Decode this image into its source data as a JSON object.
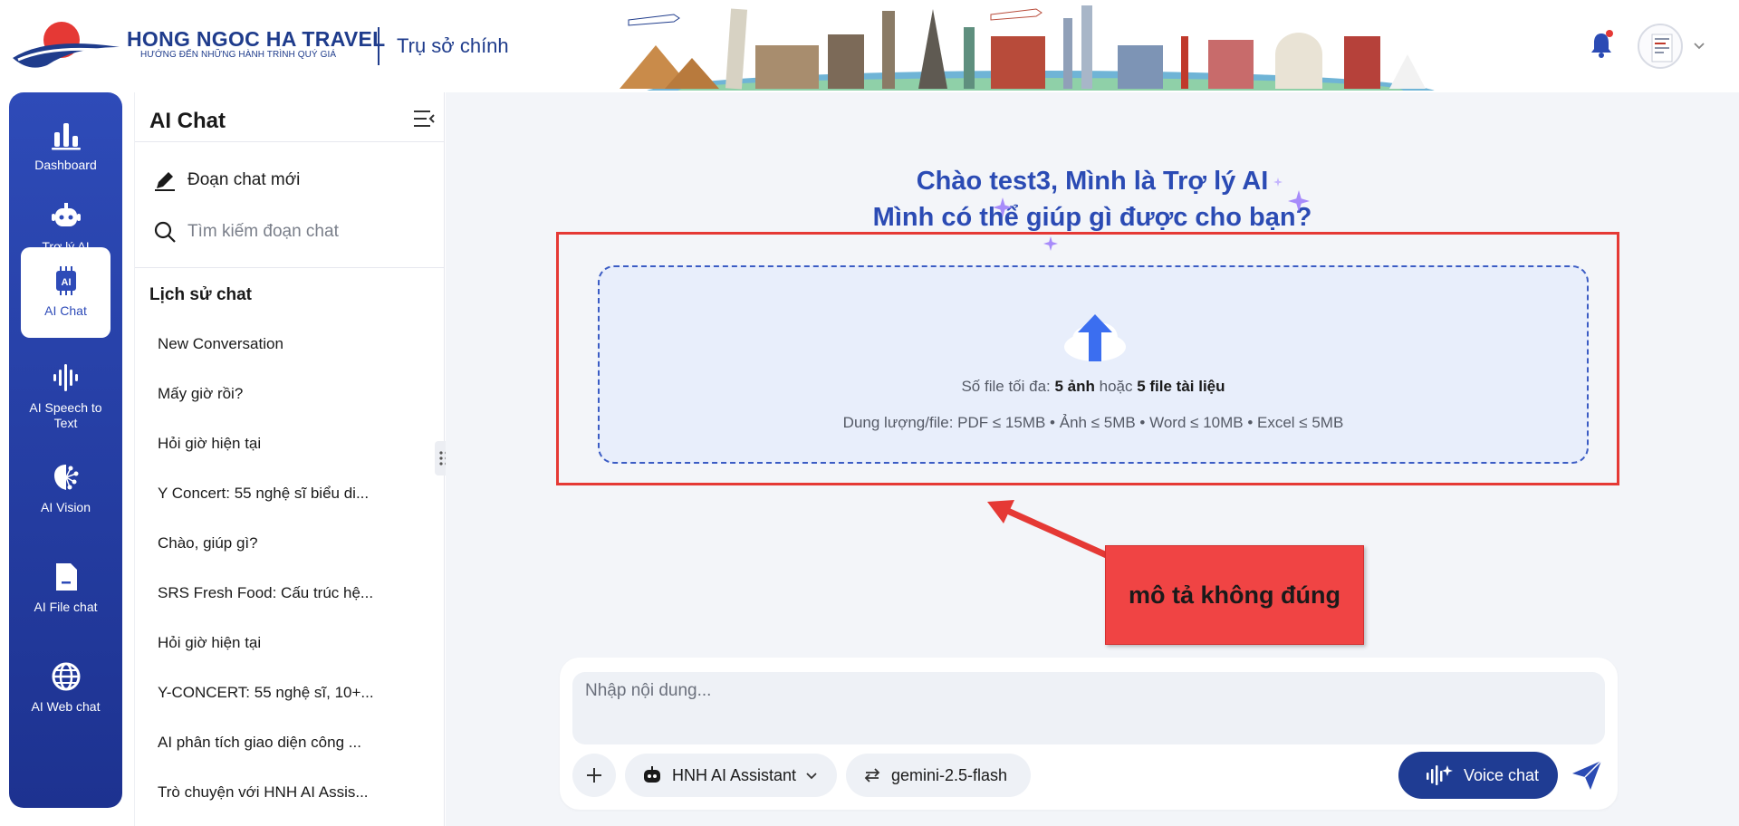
{
  "header": {
    "brand_name": "HONG NGOC HA TRAVEL",
    "brand_tagline": "HƯỚNG ĐẾN NHỮNG HÀNH TRÌNH QUÝ GIÁ",
    "office": "Trụ sở chính"
  },
  "rail": {
    "items": [
      {
        "label": "Dashboard",
        "icon": "bar-chart-icon"
      },
      {
        "label": "Trợ lý AI",
        "icon": "robot-icon"
      },
      {
        "label": "AI Chat",
        "icon": "ai-chip-icon",
        "active": true
      },
      {
        "label": "AI Speech to Text",
        "icon": "soundwave-icon"
      },
      {
        "label": "AI Vision",
        "icon": "brain-icon"
      },
      {
        "label": "AI File chat",
        "icon": "file-icon"
      },
      {
        "label": "AI Web chat",
        "icon": "globe-icon"
      }
    ]
  },
  "sidebar": {
    "title": "AI Chat",
    "new_chat": "Đoạn chat mới",
    "search_placeholder": "Tìm kiếm đoạn chat",
    "history_title": "Lịch sử chat",
    "history": [
      "New Conversation",
      "Mấy giờ rồi?",
      "Hỏi giờ hiện tại",
      "Y Concert: 55 nghệ sĩ biểu di...",
      "Chào, giúp gì?",
      "SRS Fresh Food: Cấu trúc hệ...",
      "Hỏi giờ hiện tại",
      "Y-CONCERT: 55 nghệ sĩ, 10+...",
      "AI phân tích giao diện công ...",
      "Trò chuyện với HNH AI Assis..."
    ]
  },
  "main": {
    "greeting_line1": "Chào test3, Mình là Trợ lý AI",
    "greeting_line2": "Mình có thể giúp gì được cho bạn?",
    "upload": {
      "max_prefix": "Số file tối đa: ",
      "max_images": "5 ảnh",
      "max_or": " hoặc ",
      "max_docs": "5 file tài liệu",
      "size_limits": "Dung lượng/file: PDF ≤ 15MB • Ảnh ≤ 5MB • Word ≤ 10MB • Excel ≤ 5MB"
    },
    "annotation": "mô tả không đúng",
    "composer": {
      "placeholder": "Nhập nội dung...",
      "assistant": "HNH AI Assistant",
      "model": "gemini-2.5-flash",
      "voice": "Voice chat"
    }
  },
  "colors": {
    "primary": "#2b4bb4",
    "rail_bg": "#2e4bb8",
    "annotation": "#f04444",
    "voice_btn": "#1f3c93"
  }
}
